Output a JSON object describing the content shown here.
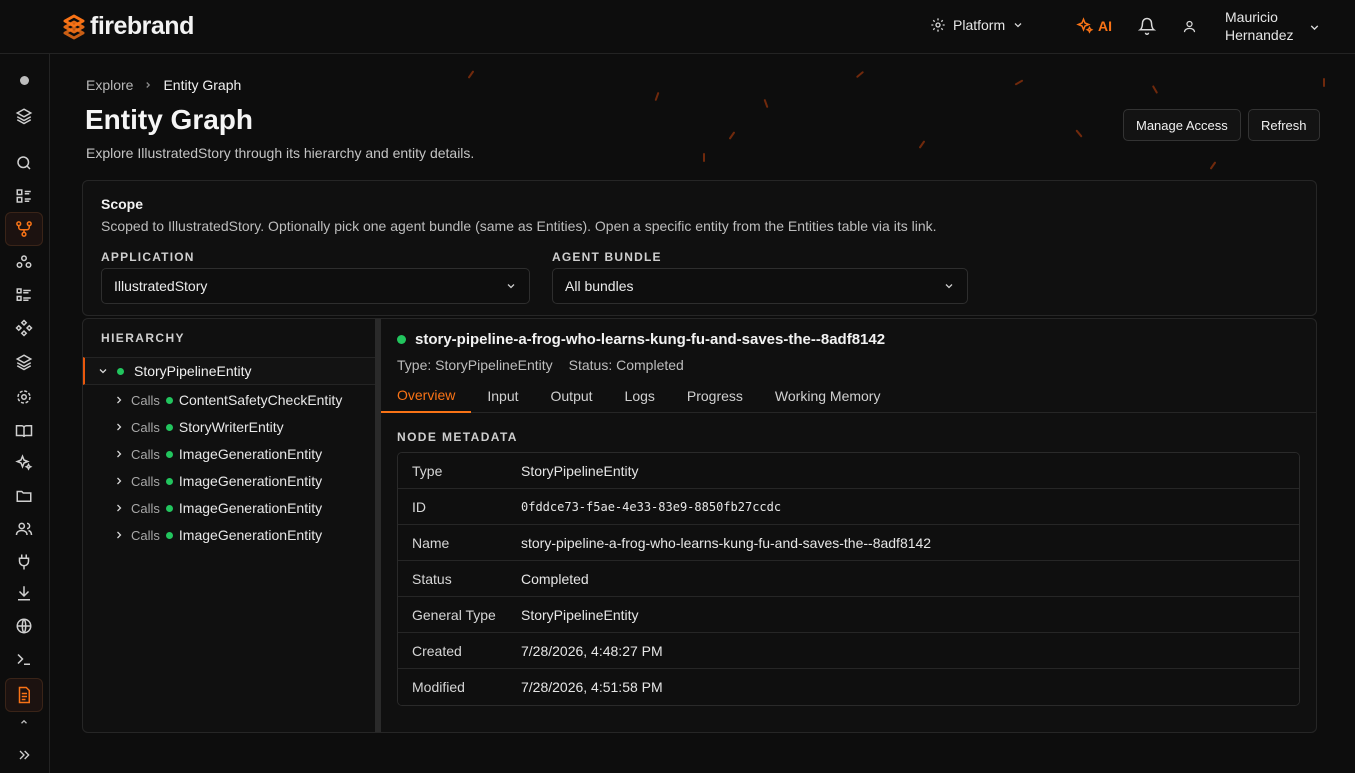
{
  "brand": {
    "name": "firebrand",
    "accent": "#f97316"
  },
  "topbar": {
    "platform_label": "Platform",
    "ai_label": "AI",
    "user_first": "Mauricio",
    "user_last": "Hernandez"
  },
  "sidebar": {
    "items": [
      "status-dot",
      "layers-icon",
      "search-icon",
      "list-icon",
      "graph-icon",
      "agents-icon",
      "tasks-icon",
      "components-icon",
      "stack-icon",
      "settings-icon",
      "book-icon",
      "sparkles-icon",
      "folder-icon",
      "users-icon",
      "plug-icon",
      "download-icon",
      "globe-icon",
      "terminal-icon",
      "document-icon",
      "expand-icon"
    ]
  },
  "breadcrumb": {
    "parent": "Explore",
    "current": "Entity Graph"
  },
  "page": {
    "title": "Entity Graph",
    "subtitle": "Explore IllustratedStory through its hierarchy and entity details."
  },
  "actions": {
    "manage_access": "Manage Access",
    "refresh": "Refresh"
  },
  "scope": {
    "title": "Scope",
    "description": "Scoped to IllustratedStory. Optionally pick one agent bundle (same as Entities). Open a specific entity from the Entities table via its link.",
    "application_label": "APPLICATION",
    "application_value": "IllustratedStory",
    "bundle_label": "AGENT BUNDLE",
    "bundle_value": "All bundles"
  },
  "hierarchy": {
    "heading": "HIERARCHY",
    "root": "StoryPipelineEntity",
    "children": [
      {
        "relation": "Calls",
        "name": "ContentSafetyCheckEntity"
      },
      {
        "relation": "Calls",
        "name": "StoryWriterEntity"
      },
      {
        "relation": "Calls",
        "name": "ImageGenerationEntity"
      },
      {
        "relation": "Calls",
        "name": "ImageGenerationEntity"
      },
      {
        "relation": "Calls",
        "name": "ImageGenerationEntity"
      },
      {
        "relation": "Calls",
        "name": "ImageGenerationEntity"
      }
    ]
  },
  "details": {
    "name": "story-pipeline-a-frog-who-learns-kung-fu-and-saves-the--8adf8142",
    "type_line": "Type: StoryPipelineEntity",
    "status_line": "Status: Completed",
    "tabs": [
      "Overview",
      "Input",
      "Output",
      "Logs",
      "Progress",
      "Working Memory"
    ],
    "active_tab": "Overview",
    "metadata_heading": "NODE METADATA",
    "metadata": [
      {
        "key": "Type",
        "value": "StoryPipelineEntity"
      },
      {
        "key": "ID",
        "value": "0fddce73-f5ae-4e33-83e9-8850fb27ccdc"
      },
      {
        "key": "Name",
        "value": "story-pipeline-a-frog-who-learns-kung-fu-and-saves-the--8adf8142"
      },
      {
        "key": "Status",
        "value": "Completed"
      },
      {
        "key": "General Type",
        "value": "StoryPipelineEntity"
      },
      {
        "key": "Created",
        "value": "7/28/2026, 4:48:27 PM"
      },
      {
        "key": "Modified",
        "value": "7/28/2026, 4:51:58 PM"
      }
    ]
  }
}
